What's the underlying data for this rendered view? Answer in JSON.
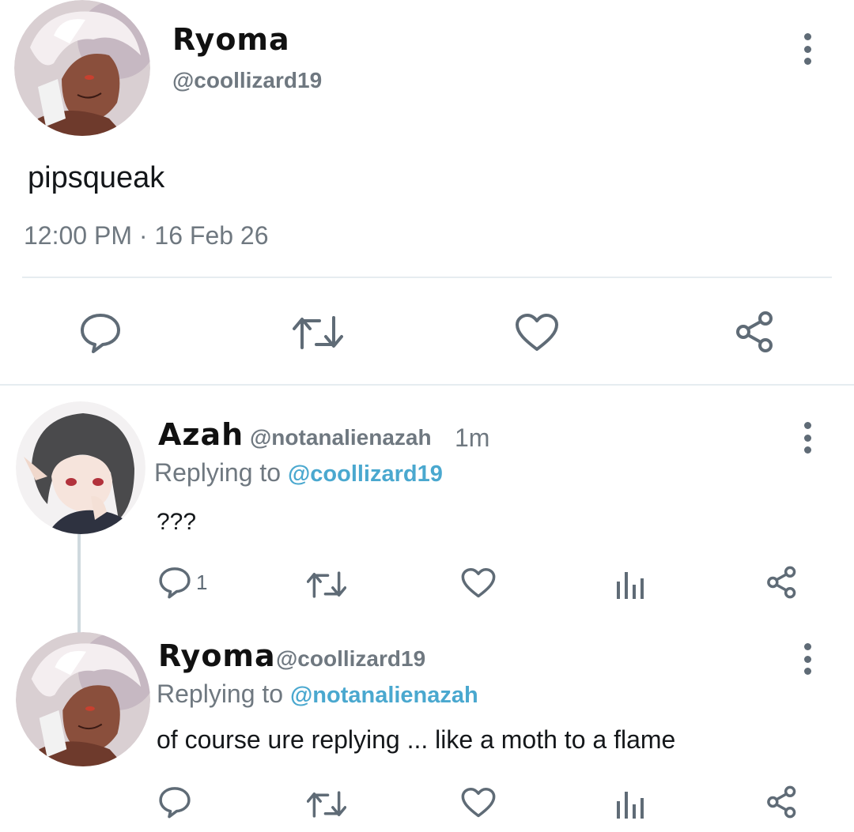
{
  "main_tweet": {
    "display_name": "Ryoma",
    "handle": "@coollizard19",
    "text": "pipsqueak",
    "timestamp": "12:00 PM · 16 Feb 26",
    "avatar_icon": "avatar-white-hair",
    "actions": [
      "reply-icon",
      "retweet-icon",
      "like-icon",
      "share-icon"
    ]
  },
  "replies": [
    {
      "display_name": "Azah",
      "handle": "@notanalienazah",
      "time": "1m",
      "replying_label": "Replying to",
      "replying_to": "@coollizard19",
      "text": "???",
      "reply_count": "1",
      "avatar_icon": "avatar-grey-hair"
    },
    {
      "display_name": "Ryoma",
      "handle": "@coollizard19",
      "replying_label": "Replying to",
      "replying_to": "@notanalienazah",
      "text": "of course ure replying ... like a moth to a flame",
      "avatar_icon": "avatar-white-hair"
    }
  ],
  "colors": {
    "accent_link": "#4aa8cf",
    "icon_grey": "#5f6b76",
    "divider": "#e6ecf0"
  }
}
